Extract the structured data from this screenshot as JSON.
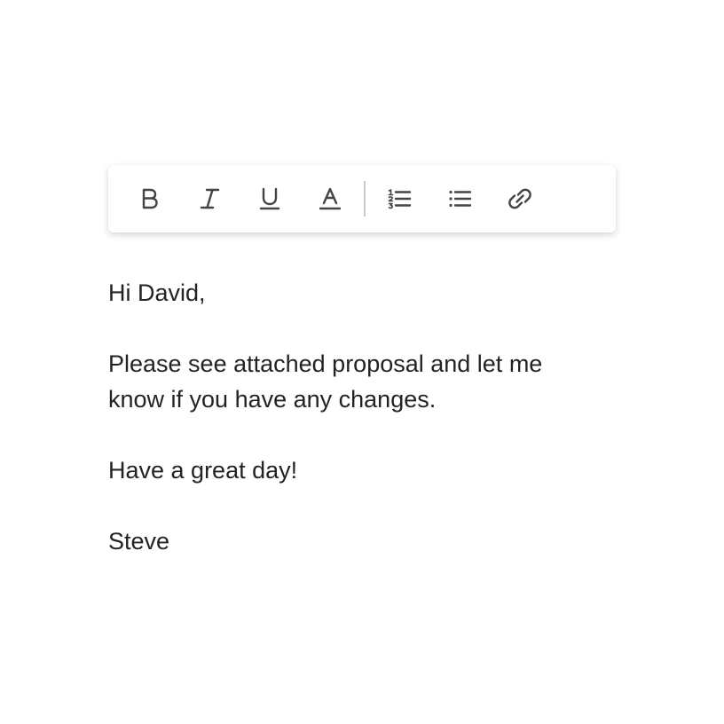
{
  "toolbar": {
    "buttons": [
      {
        "icon": "bold-icon",
        "tooltip": ""
      },
      {
        "icon": "italic-icon",
        "tooltip": ""
      },
      {
        "icon": "underline-icon",
        "tooltip": ""
      },
      {
        "icon": "text-color-icon",
        "tooltip": ""
      },
      {
        "icon": "numbered-list-icon",
        "tooltip": ""
      },
      {
        "icon": "bulleted-list-icon",
        "tooltip": ""
      },
      {
        "icon": "link-icon",
        "tooltip": ""
      }
    ],
    "icon_color": "#444444",
    "divider_color": "#c9c9c9"
  },
  "message": {
    "greeting": "Hi David,",
    "body_line1": "Please see attached proposal and let me",
    "body_line2": "know if you have any changes.",
    "closing": "Have a great day!",
    "signature": "Steve",
    "text_color": "#232323"
  }
}
